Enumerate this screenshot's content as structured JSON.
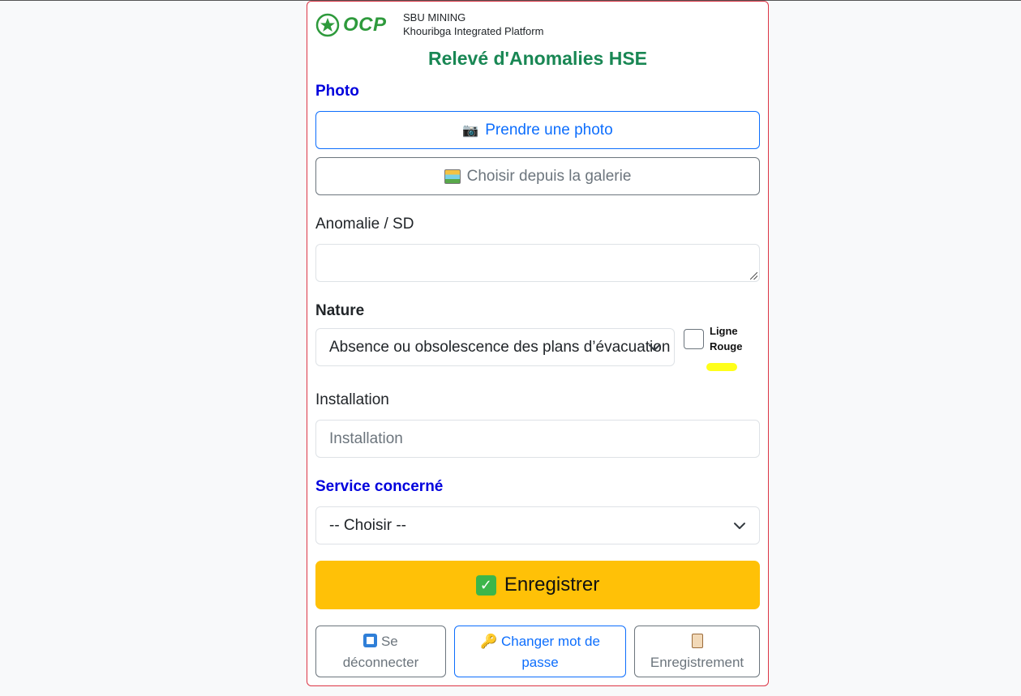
{
  "header": {
    "brand": "OCP",
    "org_line1": "SBU MINING",
    "org_line2": "Khouribga Integrated Platform",
    "title": "Relevé d'Anomalies HSE"
  },
  "photo": {
    "label": "Photo",
    "take_photo_label": "Prendre une photo",
    "take_photo_icon": "camera-icon",
    "gallery_label": "Choisir depuis la galerie",
    "gallery_icon": "picture-icon"
  },
  "anomalie": {
    "label": "Anomalie / SD",
    "value": ""
  },
  "nature": {
    "label": "Nature",
    "selected": "Absence ou obsolescence des plans d’évacuation",
    "ligne_rouge_label_1": "Ligne",
    "ligne_rouge_label_2": "Rouge",
    "ligne_rouge_checked": false,
    "highlight_color": "#ffff1a"
  },
  "installation": {
    "label": "Installation",
    "placeholder": "Installation",
    "value": ""
  },
  "service": {
    "label": "Service concerné",
    "selected": "-- Choisir --"
  },
  "actions": {
    "save_label": "Enregistrer",
    "save_color": "#ffc107",
    "logout_label_1": "Se",
    "logout_label_2": "déconnecter",
    "change_pw_label_1": "Changer mot de",
    "change_pw_label_2": "passe",
    "records_label": "Enregistrement"
  },
  "colors": {
    "accent_green": "#198754",
    "section_blue": "#0000dd",
    "card_border": "#dc3545"
  }
}
